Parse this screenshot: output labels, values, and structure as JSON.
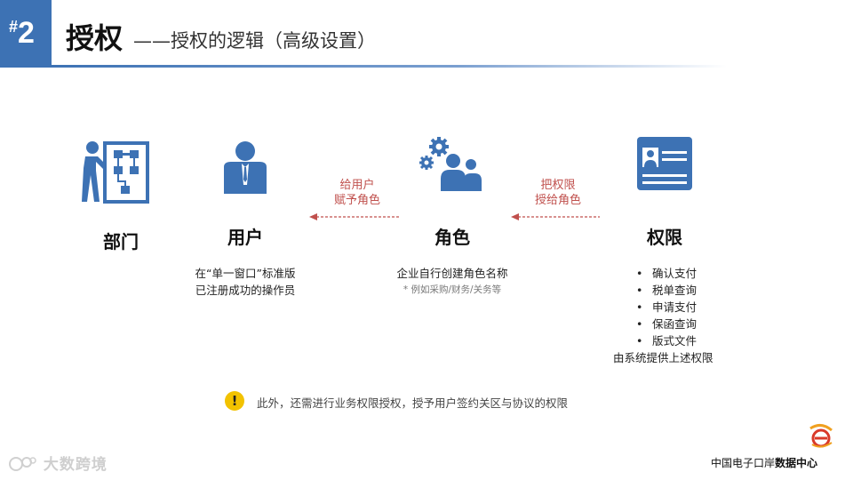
{
  "slide": {
    "hash": "#",
    "number": "2",
    "title": "授权",
    "subtitle": "——授权的逻辑（高级设置）"
  },
  "nodes": {
    "department": {
      "label": "部门",
      "icon": "org-chart-presenter-icon"
    },
    "user": {
      "label": "用户",
      "icon": "user-icon",
      "desc_line1": "在“单一窗口”标准版",
      "desc_line2": "已注册成功的操作员"
    },
    "role": {
      "label": "角色",
      "icon": "role-group-gears-icon",
      "desc_line1": "企业自行创建角色名称",
      "desc_note": "* 例如采购/财务/关务等"
    },
    "permission": {
      "label": "权限",
      "icon": "id-card-icon",
      "items": [
        "确认支付",
        "税单查询",
        "申请支付",
        "保函查询",
        "版式文件"
      ],
      "footer": "由系统提供上述权限"
    }
  },
  "arrows": {
    "role_to_user": {
      "line1": "给用户",
      "line2": "赋予角色"
    },
    "perm_to_role": {
      "line1": "把权限",
      "line2": "授给角色"
    }
  },
  "notice": {
    "icon": "exclamation-icon",
    "text": "此外，还需进行业务权限授权，授予用户签约关区与协议的权限"
  },
  "watermark": {
    "text": "大数跨境",
    "icon": "wechat-style-logo-icon"
  },
  "footer": {
    "prefix": "中国电子口岸",
    "bold": "数据中心"
  },
  "colors": {
    "accent": "#3d72b4",
    "arrow": "#c0504d",
    "warning": "#f2c200"
  }
}
